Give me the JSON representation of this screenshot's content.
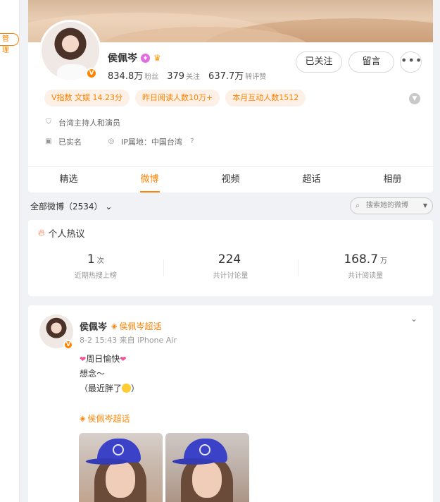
{
  "side": {
    "tag": "管理"
  },
  "profile": {
    "name": "侯佩岑",
    "verified_badge": "V",
    "stats": [
      {
        "num": "834.8万",
        "label": "粉丝"
      },
      {
        "num": "379",
        "label": "关注"
      },
      {
        "num": "637.7万",
        "label": "转评赞"
      }
    ],
    "buttons": {
      "follow": "已关注",
      "message": "留言",
      "more": "•••"
    },
    "pills": [
      "V指数 文娱 14.23分",
      "昨日阅读人数10万+",
      "本月互动人数1512"
    ],
    "bio": "台湾主持人和演员",
    "verified_text": "已实名",
    "ip": "IP属地：中国台湾"
  },
  "tabs": [
    "精选",
    "微博",
    "视频",
    "超话",
    "相册"
  ],
  "active_tab": "微博",
  "filter": {
    "label": "全部微博（2534）",
    "search_placeholder": "搜索她的微博"
  },
  "heat": {
    "title": "个人热议",
    "items": [
      {
        "value": "1",
        "unit": "次",
        "label": "近期热搜上榜"
      },
      {
        "value": "224",
        "unit": "",
        "label": "共计讨论量"
      },
      {
        "value": "168.7",
        "unit": "万",
        "label": "共计阅读量"
      }
    ]
  },
  "post": {
    "author": "侯佩岑",
    "chaohua": "侯佩岑超话",
    "meta": "8-2 15:43  来自 iPhone Air",
    "line1": "周日愉快",
    "line2": "想念～",
    "line3a": "（最近胖了",
    "line3b": "）",
    "topic": "侯佩岑超话"
  },
  "colors": {
    "accent": "#ff8200",
    "pill_bg": "#fdf0e6",
    "page_bg": "#f1f2f5"
  },
  "icons": {
    "more": "more-dots-icon",
    "collapse": "chevron-down-icon",
    "bio": "shield-icon",
    "verified": "id-card-icon",
    "ip": "location-icon",
    "search": "search-icon",
    "flame": "flame-icon",
    "diamond": "diamond-icon"
  }
}
